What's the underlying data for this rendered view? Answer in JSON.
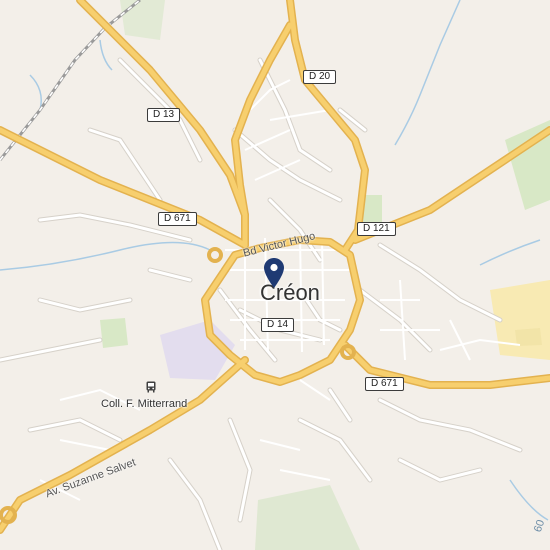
{
  "map": {
    "place_name": "Créon",
    "road_labels": {
      "d13": "D 13",
      "d20": "D 20",
      "d671_west": "D 671",
      "d671_east": "D 671",
      "d121": "D 121",
      "d14": "D 14"
    },
    "street_labels": {
      "bd_victor_hugo": "Bd Victor Hugo",
      "av_suzanne_salvet": "Av. Suzanne Salvet"
    },
    "poi": {
      "school_name": "Coll. F. Mitterrand",
      "school_icon": "bus-stop-icon"
    },
    "edge_label": "60",
    "marker_icon": "location-pin-icon",
    "colors": {
      "background": "#f3efe9",
      "major_road": "#f7cf6e",
      "major_road_casing": "#e3b24f",
      "minor_road": "#ffffff",
      "minor_road_casing": "#d6d1c9",
      "water": "#a9cbe4",
      "park": "#d8e8c6",
      "school_area": "#e3ddee",
      "industrial": "#f8eab3",
      "railway": "#9a9a9a",
      "marker": "#1f3a73"
    }
  }
}
